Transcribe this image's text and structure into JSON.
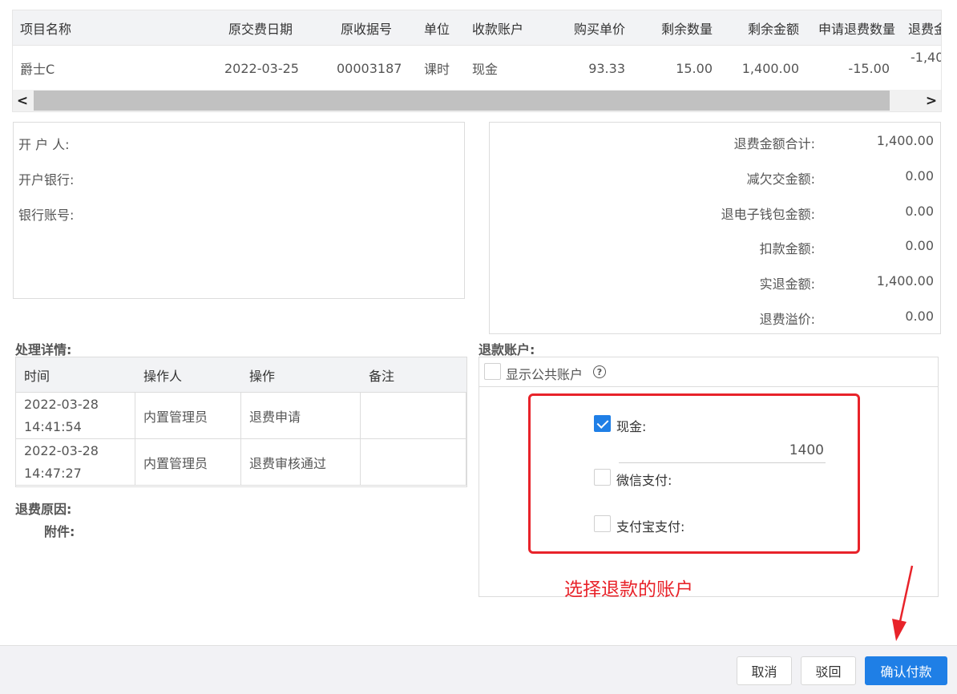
{
  "refund_items_table": {
    "columns": [
      "项目名称",
      "原交费日期",
      "原收据号",
      "单位",
      "收款账户",
      "购买单价",
      "剩余数量",
      "剩余金额",
      "申请退费数量",
      "退费金"
    ],
    "rows": [
      [
        "爵士C",
        "2022-03-25",
        "00003187",
        "课时",
        "现金",
        "93.33",
        "15.00",
        "1,400.00",
        "-15.00",
        "-1,40"
      ]
    ],
    "scroll_left": "<",
    "scroll_right": ">"
  },
  "bank_info": {
    "account_holder_label": "开 户  人:",
    "bank_label": "开户银行:",
    "account_no_label": "银行账号:"
  },
  "summary": {
    "items": [
      {
        "label": "退费金额合计:",
        "value": "1,400.00"
      },
      {
        "label": "减欠交金额:",
        "value": "0.00"
      },
      {
        "label": "退电子钱包金额:",
        "value": "0.00"
      },
      {
        "label": "扣款金额:",
        "value": "0.00"
      },
      {
        "label": "实退金额:",
        "value": "1,400.00"
      },
      {
        "label": "退费溢价:",
        "value": "0.00"
      }
    ]
  },
  "process": {
    "title": "处理详情:",
    "columns": [
      "时间",
      "操作人",
      "操作",
      "备注"
    ],
    "rows": [
      [
        "2022-03-28 14:41:54",
        "内置管理员",
        "退费申请",
        ""
      ],
      [
        "2022-03-28 14:47:27",
        "内置管理员",
        "退费审核通过",
        ""
      ]
    ],
    "reason_label": "退费原因:",
    "attachment_label": "附件:"
  },
  "refund_account": {
    "title": "退款账户:",
    "show_public_label": "显示公共账户",
    "help_icon": "?",
    "options": [
      {
        "label": "现金:",
        "checked": true,
        "amount": "1400"
      },
      {
        "label": "微信支付:",
        "checked": false
      },
      {
        "label": "支付宝支付:",
        "checked": false
      }
    ],
    "annotation": "选择退款的账户",
    "annotation_color": "#e8232a"
  },
  "footer": {
    "cancel_label": "取消",
    "reject_label": "驳回",
    "confirm_label": "确认付款",
    "primary_color": "#1f7fe6"
  }
}
